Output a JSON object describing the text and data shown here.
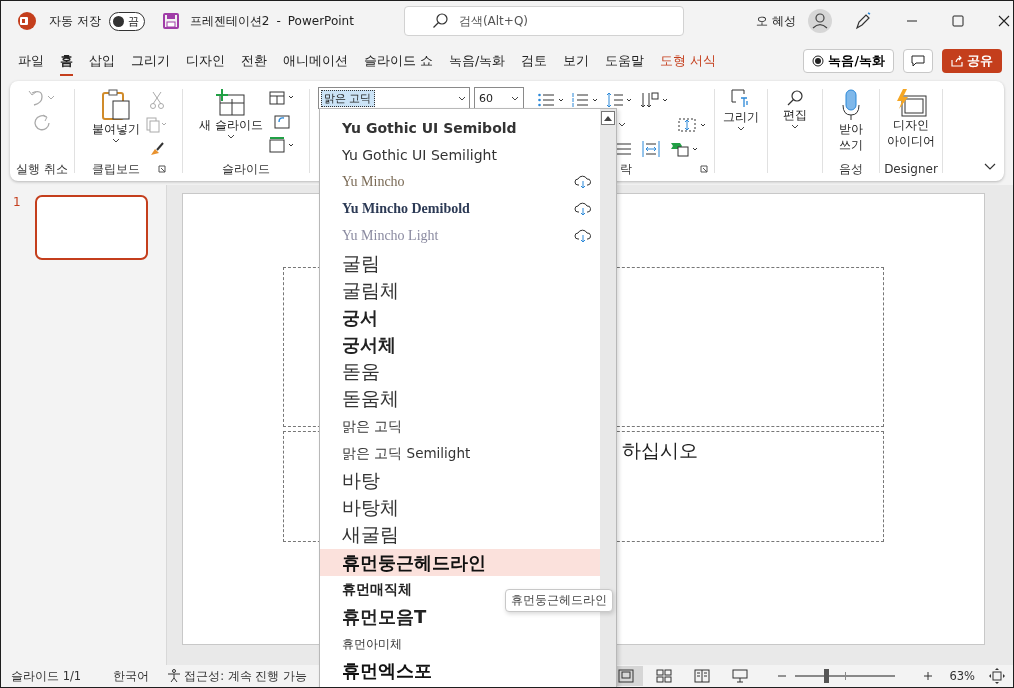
{
  "titlebar": {
    "autosave_label": "자동 저장",
    "autosave_toggle": {
      "label": "끔",
      "on": false
    },
    "doc_title": "프레젠테이션2",
    "separator": "-",
    "app_name": "PowerPoint",
    "search_placeholder": "검색(Alt+Q)",
    "user_name": "오 혜성"
  },
  "menu_tabs": [
    {
      "label": "파일",
      "selected": false,
      "kind": "normal"
    },
    {
      "label": "홈",
      "selected": true,
      "kind": "normal"
    },
    {
      "label": "삽입",
      "selected": false,
      "kind": "normal"
    },
    {
      "label": "그리기",
      "selected": false,
      "kind": "normal"
    },
    {
      "label": "디자인",
      "selected": false,
      "kind": "normal"
    },
    {
      "label": "전환",
      "selected": false,
      "kind": "normal"
    },
    {
      "label": "애니메이션",
      "selected": false,
      "kind": "normal"
    },
    {
      "label": "슬라이드 쇼",
      "selected": false,
      "kind": "normal"
    },
    {
      "label": "녹음/녹화",
      "selected": false,
      "kind": "normal"
    },
    {
      "label": "검토",
      "selected": false,
      "kind": "normal"
    },
    {
      "label": "보기",
      "selected": false,
      "kind": "normal"
    },
    {
      "label": "도움말",
      "selected": false,
      "kind": "normal"
    },
    {
      "label": "도형 서식",
      "selected": false,
      "kind": "contextual"
    }
  ],
  "record_button": "녹음/녹화",
  "share_button": "공유",
  "ribbon": {
    "undo_group": "실행 취소",
    "paste": "붙여넣기",
    "clipboard_group": "클립보드",
    "new_slide": "새 슬라이드",
    "slides_group": "슬라이드",
    "font_name": "맑은 고딕",
    "font_size": "60",
    "paragraph_group_fragment": "락",
    "draw": "그리기",
    "edit": "편집",
    "dictate": [
      "받아",
      "쓰기"
    ],
    "voice_group": "음성",
    "designer": [
      "디자인",
      "아이디어"
    ],
    "designer_group": "Designer"
  },
  "thumbnails": [
    {
      "number": "1",
      "selected": true
    }
  ],
  "slide": {
    "subtitle_fragment": "하십시오"
  },
  "font_list": [
    {
      "name": "Yu Gothic UI Semibold",
      "kind": "semibold",
      "downloadable": false,
      "selected": false
    },
    {
      "name": "Yu Gothic UI Semilight",
      "kind": "semilight",
      "downloadable": false,
      "selected": false
    },
    {
      "name": "Yu Mincho",
      "kind": "serif",
      "downloadable": true,
      "selected": false
    },
    {
      "name": "Yu Mincho Demibold",
      "kind": "serifbold",
      "downloadable": true,
      "selected": false
    },
    {
      "name": "Yu Mincho Light",
      "kind": "seriflight",
      "downloadable": true,
      "selected": false
    },
    {
      "name": "굴림",
      "kind": "large",
      "downloadable": false,
      "selected": false
    },
    {
      "name": "굴림체",
      "kind": "large",
      "downloadable": false,
      "selected": false
    },
    {
      "name": "궁서",
      "kind": "bold",
      "downloadable": false,
      "selected": false
    },
    {
      "name": "궁서체",
      "kind": "bold",
      "downloadable": false,
      "selected": false
    },
    {
      "name": "돋움",
      "kind": "large",
      "downloadable": false,
      "selected": false
    },
    {
      "name": "돋움체",
      "kind": "large",
      "downloadable": false,
      "selected": false
    },
    {
      "name": "맑은 고딕",
      "kind": "small",
      "downloadable": false,
      "selected": false
    },
    {
      "name": "맑은 고딕 Semilight",
      "kind": "small",
      "downloadable": false,
      "selected": false
    },
    {
      "name": "바탕",
      "kind": "large",
      "downloadable": false,
      "selected": false
    },
    {
      "name": "바탕체",
      "kind": "large",
      "downloadable": false,
      "selected": false
    },
    {
      "name": "새굴림",
      "kind": "large",
      "downloadable": false,
      "selected": false
    },
    {
      "name": "휴먼둥근헤드라인",
      "kind": "black",
      "downloadable": false,
      "selected": true
    },
    {
      "name": "휴먼매직체",
      "kind": "medium",
      "downloadable": false,
      "selected": false
    },
    {
      "name": "휴먼모음T",
      "kind": "bold",
      "downloadable": false,
      "selected": false
    },
    {
      "name": "휴먼아미체",
      "kind": "tiny",
      "downloadable": false,
      "selected": false
    },
    {
      "name": "휴먼엑스포",
      "kind": "black",
      "downloadable": false,
      "selected": false
    }
  ],
  "tooltip": "휴먼둥근헤드라인",
  "status_bar": {
    "slide_count": "슬라이드 1/1",
    "language": "한국어",
    "accessibility": "접근성: 계속 진행 가능",
    "views": [
      {
        "kind": "normal",
        "selected": true
      },
      {
        "kind": "sorter",
        "selected": false
      },
      {
        "kind": "reading",
        "selected": false
      },
      {
        "kind": "show",
        "selected": false
      }
    ],
    "zoom": {
      "level": 0.31
    },
    "zoom_value": "63%"
  }
}
